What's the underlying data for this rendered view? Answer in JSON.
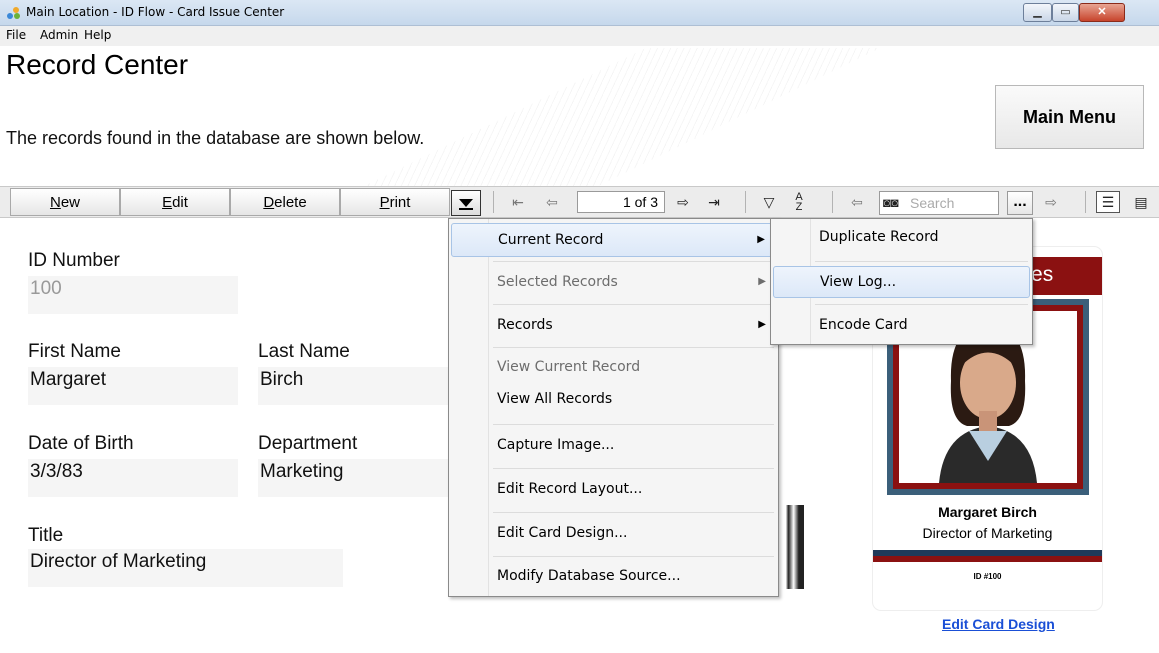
{
  "window": {
    "title": "Main Location - ID Flow - Card Issue Center"
  },
  "menubar": {
    "file": "File",
    "admin": "Admin",
    "help": "Help"
  },
  "header": {
    "title": "Record Center",
    "subtitle": "The records found in the database are shown below.",
    "main_menu": "Main Menu"
  },
  "toolbar": {
    "new": "New",
    "edit": "Edit",
    "delete": "Delete",
    "print": "Print",
    "page": "1 of 3",
    "search_placeholder": "Search",
    "ellipsis": "..."
  },
  "form": {
    "id_label": "ID Number",
    "id_value": "100",
    "first_label": "First Name",
    "first_value": "Margaret",
    "last_label": "Last Name",
    "last_value": "Birch",
    "dob_label": "Date of Birth",
    "dob_value": "3/3/83",
    "dept_label": "Department",
    "dept_value": "Marketing",
    "title_label": "Title",
    "title_value": "Director of Marketing"
  },
  "card": {
    "banner": "ogies",
    "name": "Margaret Birch",
    "title": "Director of Marketing",
    "id_text": "ID #100",
    "edit_link": "Edit Card Design",
    "colors": {
      "banner": "#8b1111",
      "frame": "#3b5f7a"
    }
  },
  "menu": {
    "items": [
      "Current Record",
      "Selected Records",
      "Records",
      "View Current Record",
      "View All Records",
      "Capture Image...",
      "Edit Record Layout...",
      "Edit Card Design...",
      "Modify Database Source..."
    ]
  },
  "submenu": {
    "items": [
      "Duplicate Record",
      "View Log...",
      "Encode Card"
    ]
  },
  "icons": {
    "first": "first-record-icon",
    "prev": "previous-record-icon",
    "next": "next-record-icon",
    "last": "last-record-icon",
    "filter": "filter-icon",
    "sort": "sort-icon",
    "search": "binoculars-icon",
    "view_form": "form-view-icon",
    "view_list": "list-view-icon"
  }
}
